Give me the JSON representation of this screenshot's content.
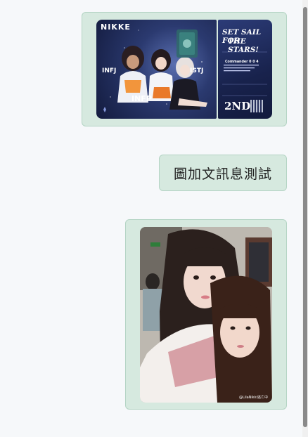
{
  "messages": [
    {
      "type": "image",
      "card": {
        "logo": "NIKKE",
        "mbti_labels": [
          "INFJ",
          "ISTJ",
          "INFP"
        ],
        "headline_line1": "SET SAIL FOR",
        "headline_line2": "THE STARS!",
        "commander": "Commander 0 0 4",
        "anniversary": "2ND"
      }
    },
    {
      "type": "text",
      "text": "圖加文訊息測試"
    },
    {
      "type": "image",
      "caption": "@LilaNikki逃亡中"
    }
  ],
  "colors": {
    "bubble_bg": "#d6e9df",
    "bubble_border": "#b4d4c4",
    "page_bg": "#f6f8fa"
  }
}
